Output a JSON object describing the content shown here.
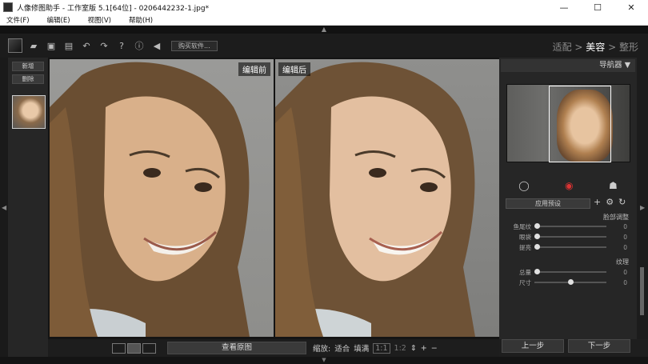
{
  "window": {
    "title": "人像修图助手 - 工作室版 5.1[64位] - 0206442232-1.jpg*",
    "minimize": "—",
    "maximize": "☐",
    "close": "✕"
  },
  "menu": [
    "文件(F)",
    "编辑(E)",
    "视图(V)",
    "帮助(H)"
  ],
  "toolbar": {
    "icons": [
      "open-icon",
      "save-icon",
      "save-as-icon",
      "undo-icon",
      "redo-icon",
      "help-icon",
      "info-icon",
      "sound-icon"
    ],
    "buy_label": "购买软件..."
  },
  "modes": {
    "fit": "适配",
    "sep1": " > ",
    "beauty": "美容",
    "sep2": " > ",
    "shape": "整形"
  },
  "left_panel": {
    "new_label": "新增",
    "delete_label": "删除"
  },
  "viewer": {
    "before_label": "编辑前",
    "after_label": "编辑后"
  },
  "bottom": {
    "view_original": "查看原图",
    "zoom_label": "缩放:",
    "fit": "适合",
    "fill": "填满",
    "zoom_1_1": "1:1",
    "zoom_1_2": "1:2",
    "plus": "+",
    "minus": "−"
  },
  "right_panel": {
    "navigator_title": "导航器 ▼",
    "preset_label": "应用预设",
    "face_section": "脸部调整",
    "sliders_face": [
      {
        "label": "鱼尾纹",
        "value": "0",
        "level": 0.0
      },
      {
        "label": "眼袋",
        "value": "0",
        "level": 0.0
      },
      {
        "label": "提亮",
        "value": "0",
        "level": 0.0
      }
    ],
    "texture_section": "纹理",
    "sliders_texture": [
      {
        "label": "总量",
        "value": "0",
        "level": 0.0
      },
      {
        "label": "尺寸",
        "value": "0",
        "level": 0.5
      }
    ],
    "prev_label": "上一步",
    "next_label": "下一步"
  }
}
